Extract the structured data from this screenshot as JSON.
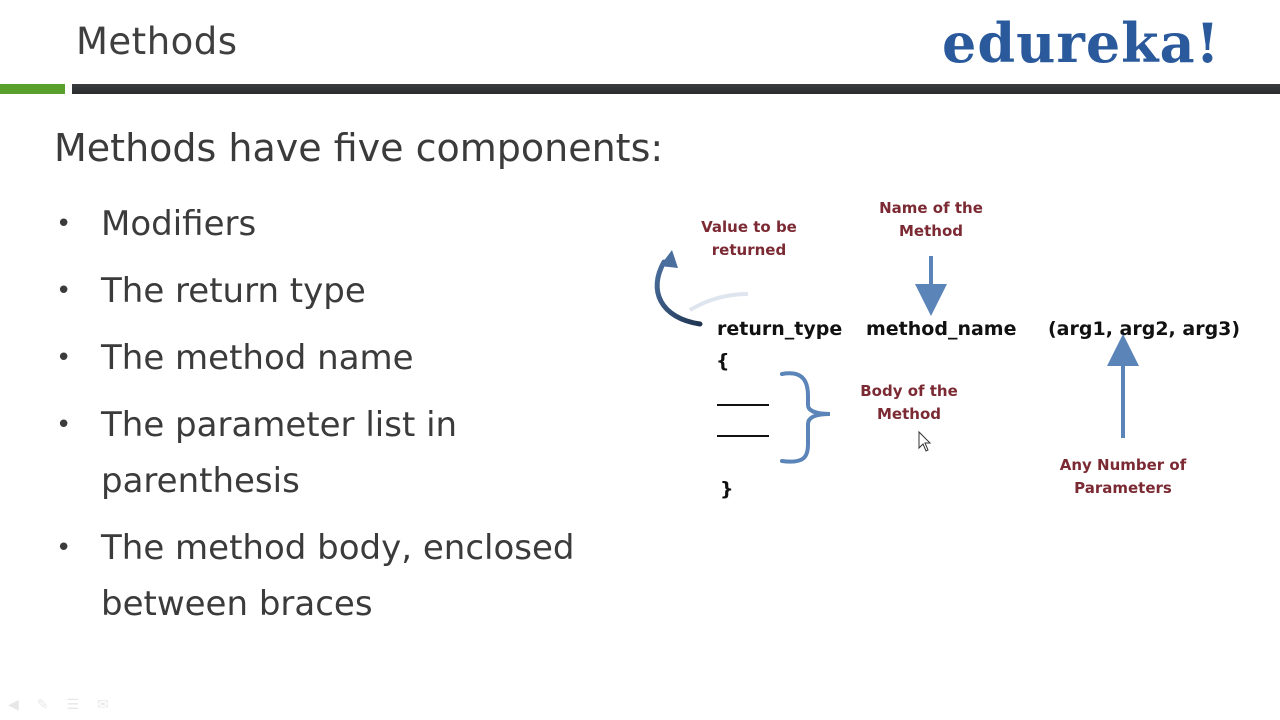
{
  "slide": {
    "title": "Methods",
    "logo_text": "edureka!",
    "colors": {
      "accent_green": "#5aa02c",
      "header_bar": "#2f3133",
      "logo_blue": "#2a5a9c",
      "annotation_red": "#7b2a33",
      "arrow_blue": "#5b84b8"
    }
  },
  "content": {
    "intro": "Methods have five components:",
    "bullets": [
      {
        "label": "Modifiers"
      },
      {
        "label": "The return type"
      },
      {
        "label": "The method name"
      },
      {
        "label": "The parameter list in parenthesis"
      },
      {
        "label": "The method body, enclosed between braces"
      }
    ]
  },
  "diagram": {
    "signature": {
      "return_type": "return_type",
      "method_name": "method_name",
      "params": "(arg1, arg2, arg3)"
    },
    "open_brace": "{",
    "close_brace": "}",
    "annotations": {
      "return_value": "Value to be returned",
      "method_name": "Name of the Method",
      "body": "Body of the Method",
      "params": "Any Number of Parameters"
    }
  },
  "player_controls": {
    "icons": [
      "back-icon",
      "pen-icon",
      "menu-icon",
      "comment-icon"
    ]
  }
}
